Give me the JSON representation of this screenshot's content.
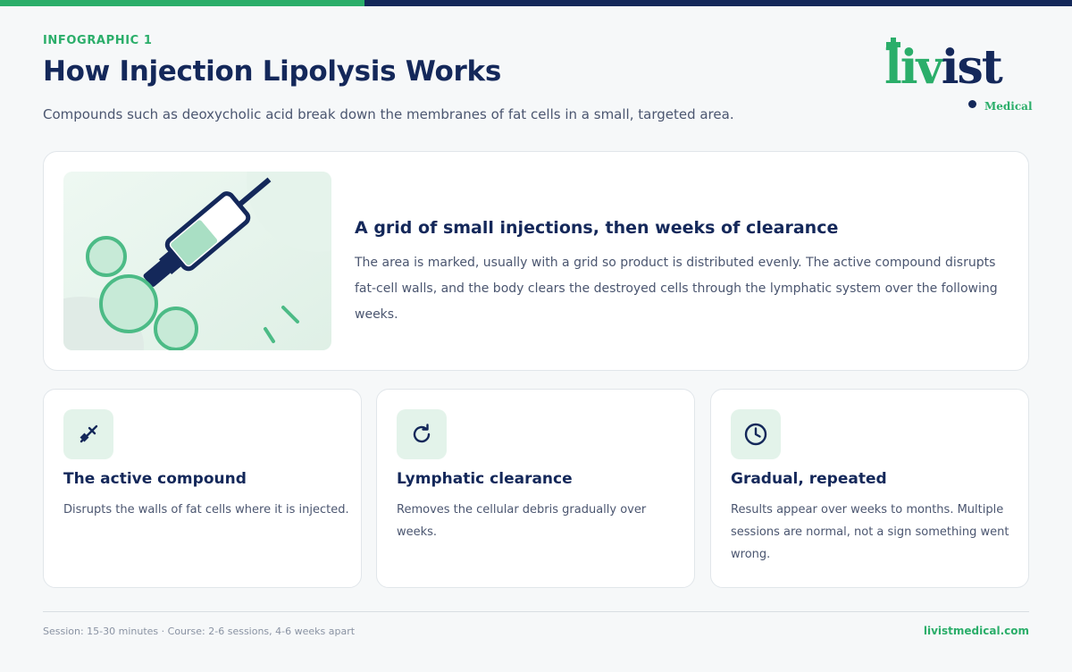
{
  "header": {
    "eyebrow": "INFOGRAPHIC 1",
    "title": "How Injection Lipolysis Works",
    "subtitle": "Compounds such as deoxycholic acid break down the membranes of fat cells in a small, targeted area."
  },
  "logo": {
    "wordmark_green": "liv",
    "wordmark_navy": "ist",
    "tagline": "Medical"
  },
  "hero": {
    "illustration": "syringe-injecting-fat-cells",
    "title": "A grid of small injections, then weeks of clearance",
    "body": "The area is marked, usually with a grid so product is distributed evenly. The active compound disrupts fat-cell walls, and the body clears the destroyed cells through the lymphatic system over the following weeks."
  },
  "cards": [
    {
      "icon": "syringe-icon",
      "title": "The active compound",
      "body": "Disrupts the walls of fat cells where it is injected."
    },
    {
      "icon": "refresh-icon",
      "title": "Lymphatic clearance",
      "body": "Removes the cellular debris gradually over weeks."
    },
    {
      "icon": "clock-icon",
      "title": "Gradual, repeated",
      "body": "Results appear over weeks to months. Multiple sessions are normal, not a sign something went wrong."
    }
  ],
  "footer": {
    "left": "Session: 15-30 minutes · Course: 2-6 sessions, 4-6 weeks apart",
    "right": "livistmedical.com"
  },
  "colors": {
    "accent_green": "#2bae6a",
    "navy": "#14285a",
    "icon_bg": "#e3f3ea"
  }
}
